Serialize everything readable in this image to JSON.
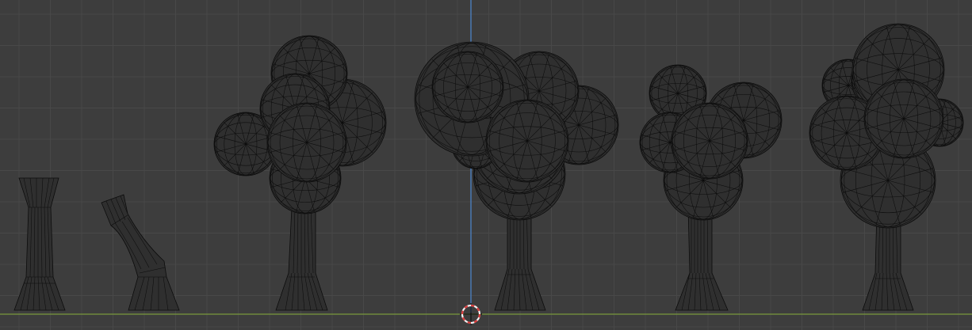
{
  "viewport": {
    "view": "orthographic-front",
    "shading": "wireframe",
    "background_color": "#3d3d3d",
    "grid_color": "#484848",
    "x_axis_color": "#6f8a3d",
    "z_axis_color": "#4a79b4",
    "cursor_colors": [
      "#d93a3a",
      "#f2f2f2"
    ],
    "mesh_fill_color": "#2f2f2f",
    "mesh_wire_color": "#0c0c0c"
  },
  "objects": [
    {
      "name": "trunk-straight",
      "kind": "trunk"
    },
    {
      "name": "trunk-bent",
      "kind": "trunk"
    },
    {
      "name": "tree-1",
      "kind": "tree"
    },
    {
      "name": "tree-2",
      "kind": "tree"
    },
    {
      "name": "tree-3",
      "kind": "tree"
    },
    {
      "name": "tree-4",
      "kind": "tree"
    }
  ]
}
